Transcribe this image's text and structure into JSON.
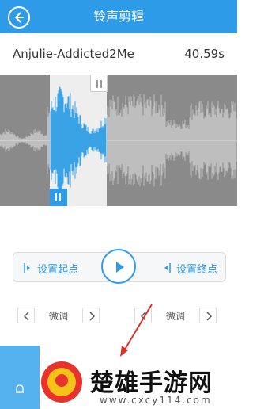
{
  "header": {
    "title": "铃声剪辑",
    "back_icon": "back-arrow-icon",
    "background_color": "#2e9be8"
  },
  "track": {
    "name": "Anjulie-Addicted2Me",
    "duration": "40.59s"
  },
  "waveform": {
    "selected_color": "#3aa3e6",
    "unselected_color": "#c8c8c8",
    "background_color": "#8a8a8a"
  },
  "controls": {
    "set_start_label": "设置起点",
    "set_end_label": "设置终点",
    "play_icon": "play-icon"
  },
  "fine_tune": {
    "left_label": "微调",
    "right_label": "微调"
  },
  "watermark": {
    "brand_name": "楚雄手游网",
    "url": "www.cxcy114.com"
  }
}
